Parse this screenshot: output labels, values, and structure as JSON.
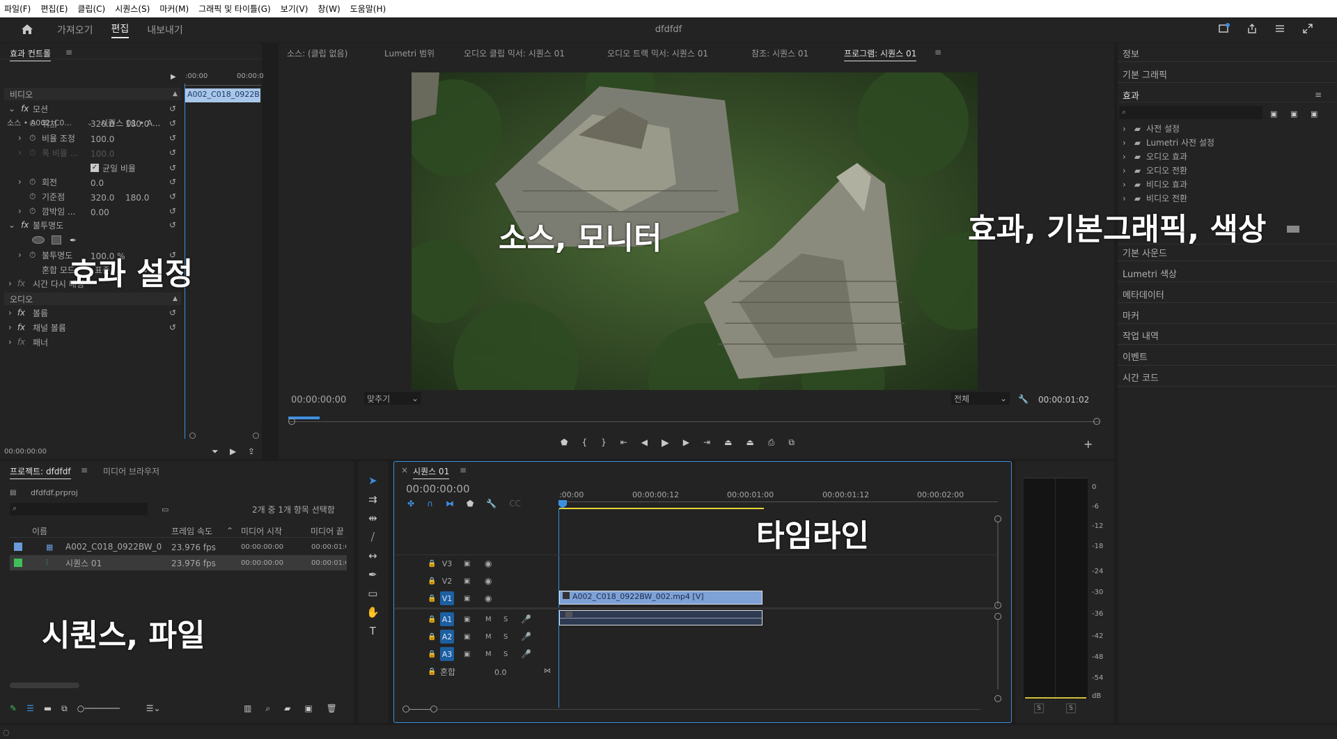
{
  "menu": [
    "파일(F)",
    "편집(E)",
    "클립(C)",
    "시퀀스(S)",
    "마커(M)",
    "그래픽 및 타이틀(G)",
    "보기(V)",
    "창(W)",
    "도움말(H)"
  ],
  "header": {
    "tabs": [
      "가져오기",
      "편집",
      "내보내기"
    ],
    "active_tab": "편집",
    "project_title": "dfdfdf"
  },
  "effect_controls": {
    "panel_title": "효과 컨트롤",
    "source": "소스 • A002_C0...",
    "sequence": "시퀀스 01 • A...",
    "mini_time_start": ":00:00",
    "mini_time_end": "00:00:0",
    "clip_label": "A002_C018_0922B",
    "video_header": "비디오",
    "motion": "모션",
    "position_label": "위치",
    "position_x": "320.0",
    "position_y": "180.0",
    "scale_label": "비율 조정",
    "scale_value": "100.0",
    "scale_width_label": "폭 비율 ...",
    "scale_width_value": "100.0",
    "uniform_scale": "균일 비율",
    "rotation_label": "회전",
    "rotation_value": "0.0",
    "anchor_label": "기준점",
    "anchor_x": "320.0",
    "anchor_y": "180.0",
    "flicker_label": "깜박임 ...",
    "flicker_value": "0.00",
    "opacity": "불투명도",
    "opacity_label": "불투명도",
    "opacity_value": "100.0 %",
    "blend_label": "혼합 모드",
    "blend_value": "표준",
    "time_remap": "시간 다시 매핑",
    "audio_header": "오디오",
    "volume": "볼륨",
    "channel_volume": "채널 볼륨",
    "panner": "패너",
    "timecode": "00:00:00:00"
  },
  "monitor": {
    "tabs": [
      "소스: (클립 없음)",
      "Lumetri 범위",
      "오디오 클립 믹서: 시퀀스 01",
      "오디오 트랙 믹서: 시퀀스 01",
      "참조: 시퀀스 01",
      "프로그램: 시퀀스 01"
    ],
    "active_tab": "프로그램: 시퀀스 01",
    "timecode": "00:00:00:00",
    "fit": "맞추기",
    "quality": "전체",
    "duration": "00:00:01:02"
  },
  "project": {
    "tabs": [
      "프로젝트: dfdfdf",
      "미디어 브라우저"
    ],
    "file": "dfdfdf.prproj",
    "selection_info": "2개 중 1개 항목 선택함",
    "columns": [
      "이름",
      "프레임 속도",
      "미디어 시작",
      "미디어 끝"
    ],
    "rows": [
      {
        "name": "A002_C018_0922BW_0",
        "fps": "23.976 fps",
        "start": "00:00:00:00",
        "end": "00:00:01:0",
        "color": "#6a9ad8"
      },
      {
        "name": "시퀀스 01",
        "fps": "23.976 fps",
        "start": "00:00:00:00",
        "end": "00:00:01:0",
        "color": "#3fbf5a"
      }
    ]
  },
  "timeline": {
    "tab": "시퀀스 01",
    "timecode": "00:00:00:00",
    "ruler": [
      ":00:00",
      "00:00:00:12",
      "00:00:01:00",
      "00:00:01:12",
      "00:00:02:00"
    ],
    "video_tracks": [
      "V3",
      "V2",
      "V1"
    ],
    "audio_tracks": [
      "A1",
      "A2",
      "A3"
    ],
    "mix_label": "혼합",
    "mix_value": "0.0",
    "video_clip": "A002_C018_0922BW_002.mp4 [V]",
    "mute": "M",
    "solo": "S"
  },
  "meter": {
    "scale": [
      "0",
      "-6",
      "-12",
      "-18",
      "-24",
      "-30",
      "-36",
      "-42",
      "-48",
      "-54",
      "dB"
    ],
    "solo": "S"
  },
  "right_panel": {
    "info": "정보",
    "essential_graphics": "기본 그래픽",
    "effects": "효과",
    "folders": [
      "사전 설정",
      "Lumetri 사전 설정",
      "오디오 효과",
      "오디오 전환",
      "비디오 효과",
      "비디오 전환"
    ],
    "items": [
      "기본 사운드",
      "Lumetri 색상",
      "메타데이터",
      "마커",
      "작업 내역",
      "이벤트",
      "시간 코드"
    ]
  },
  "overlays": {
    "effects_settings": "효과 설정",
    "source_monitor": "소스, 모니터",
    "effects_graphics_color": "효과, 기본그래픽, 색상",
    "timeline": "타임라인",
    "sequence_file": "시퀀스, 파일"
  }
}
